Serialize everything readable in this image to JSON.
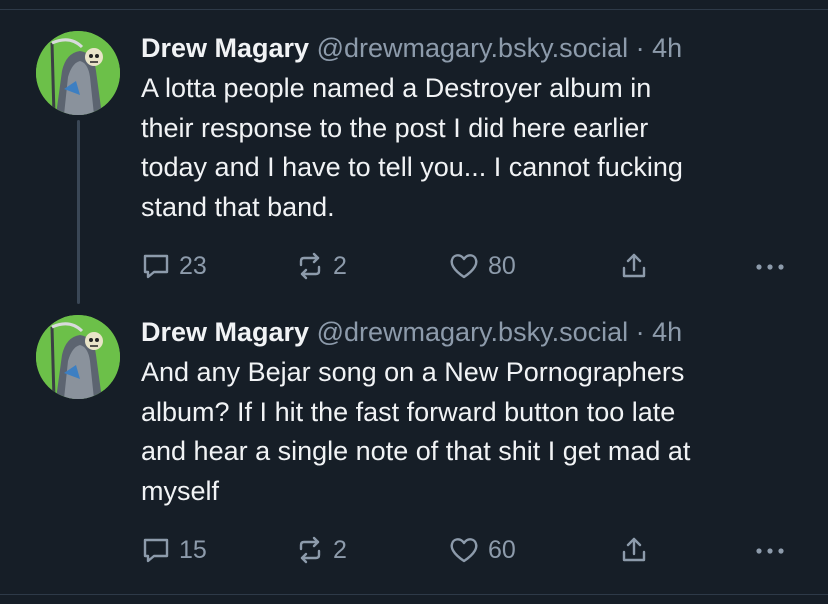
{
  "posts": [
    {
      "author": {
        "display_name": "Drew Magary",
        "handle": "@drewmagary.bsky.social",
        "avatar_icon": "grim-reaper-avatar"
      },
      "separator": "·",
      "time": "4h",
      "text": "A lotta people named a Destroyer album in their response to the post I did here earlier today and I have to tell you... I cannot fucking stand that band.",
      "text_lines": [
        "A lotta people named a Destroyer album in",
        "their response to the post I did here earlier",
        "today and I have to tell you... I cannot fucking",
        "stand that band."
      ],
      "actions": {
        "replies": "23",
        "reposts": "2",
        "likes": "80",
        "share_icon": "share-icon",
        "more_icon": "more-icon"
      }
    },
    {
      "author": {
        "display_name": "Drew Magary",
        "handle": "@drewmagary.bsky.social",
        "avatar_icon": "grim-reaper-avatar"
      },
      "separator": "·",
      "time": "4h",
      "text": "And any Bejar song on a New Pornographers album? If I hit the fast forward button too late and hear a single note of that shit I get mad at myself",
      "text_lines": [
        "And any Bejar song on a New Pornographers",
        "album? If I hit the fast forward button too late",
        "and hear a single note of that shit I get mad at",
        "myself"
      ],
      "actions": {
        "replies": "15",
        "reposts": "2",
        "likes": "60",
        "share_icon": "share-icon",
        "more_icon": "more-icon"
      }
    }
  ],
  "colors": {
    "background": "#161e27",
    "text": "#f1f3f5",
    "muted": "#8d9bab",
    "thread_line": "#3a4756",
    "avatar_bg": "#6cc049"
  }
}
